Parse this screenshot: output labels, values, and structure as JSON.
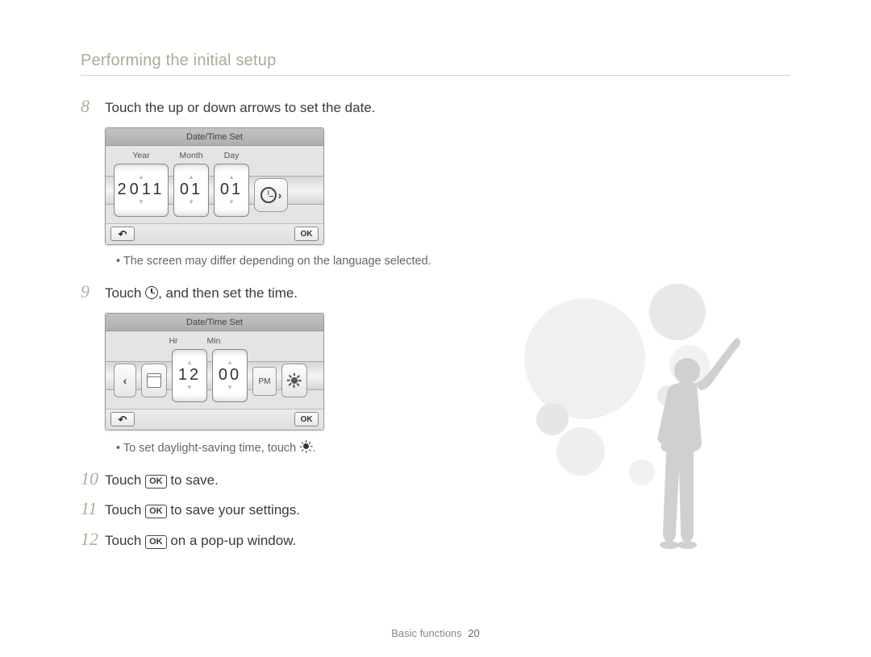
{
  "section_title": "Performing the initial setup",
  "steps": {
    "s8": {
      "num": "8",
      "text": "Touch the up or down arrows to set the date."
    },
    "s9": {
      "num": "9",
      "text_prefix": "Touch ",
      "text_suffix": ", and then set the time."
    },
    "s10": {
      "num": "10",
      "prefix": "Touch ",
      "ok": "OK",
      "suffix": " to save."
    },
    "s11": {
      "num": "11",
      "prefix": "Touch ",
      "ok": "OK",
      "suffix": " to save your settings."
    },
    "s12": {
      "num": "12",
      "prefix": "Touch ",
      "ok": "OK",
      "suffix": " on a pop-up window."
    }
  },
  "notes": {
    "n1": "The screen may differ depending on the language selected.",
    "n2_prefix": "To set daylight-saving time, touch ",
    "n2_suffix": "."
  },
  "date_screen": {
    "title": "Date/Time Set",
    "labels": {
      "year": "Year",
      "month": "Month",
      "day": "Day"
    },
    "year": "2011",
    "month": "01",
    "day": "01",
    "ok": "OK"
  },
  "time_screen": {
    "title": "Date/Time Set",
    "labels": {
      "hr": "Hr",
      "min": "Min"
    },
    "hr": "12",
    "min": "00",
    "ampm": "PM",
    "ok": "OK"
  },
  "footer": {
    "label": "Basic functions",
    "page": "20"
  }
}
